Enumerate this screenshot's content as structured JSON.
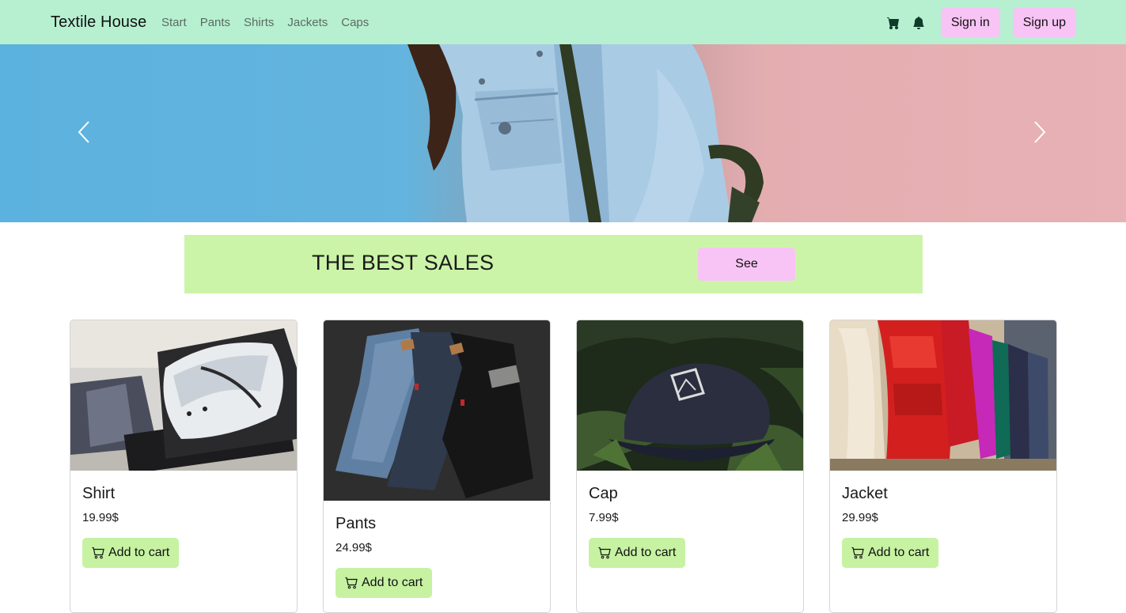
{
  "navbar": {
    "brand": "Textile House",
    "links": [
      "Start",
      "Pants",
      "Shirts",
      "Jackets",
      "Caps"
    ],
    "icons": [
      "cart-icon",
      "bell-icon"
    ],
    "sign_in": "Sign in",
    "sign_up": "Sign up"
  },
  "hero": {
    "prev_icon": "chevron-left-icon",
    "next_icon": "chevron-right-icon"
  },
  "promo": {
    "text": "THE BEST SALES",
    "button": "See"
  },
  "products": [
    {
      "name": "Shirt",
      "price": "19.99$",
      "button": "Add to cart",
      "image": "shirt-photo"
    },
    {
      "name": "Pants",
      "price": "24.99$",
      "button": "Add to cart",
      "image": "jeans-photo"
    },
    {
      "name": "Cap",
      "price": "7.99$",
      "button": "Add to cart",
      "image": "cap-photo"
    },
    {
      "name": "Jacket",
      "price": "29.99$",
      "button": "Add to cart",
      "image": "jackets-photo"
    }
  ],
  "colors": {
    "navbar_bg": "#b6f0d0",
    "auth_button_bg": "#f8c4f5",
    "promo_bg": "#ccf4a8",
    "cart_button_bg": "#c6f2a2"
  }
}
